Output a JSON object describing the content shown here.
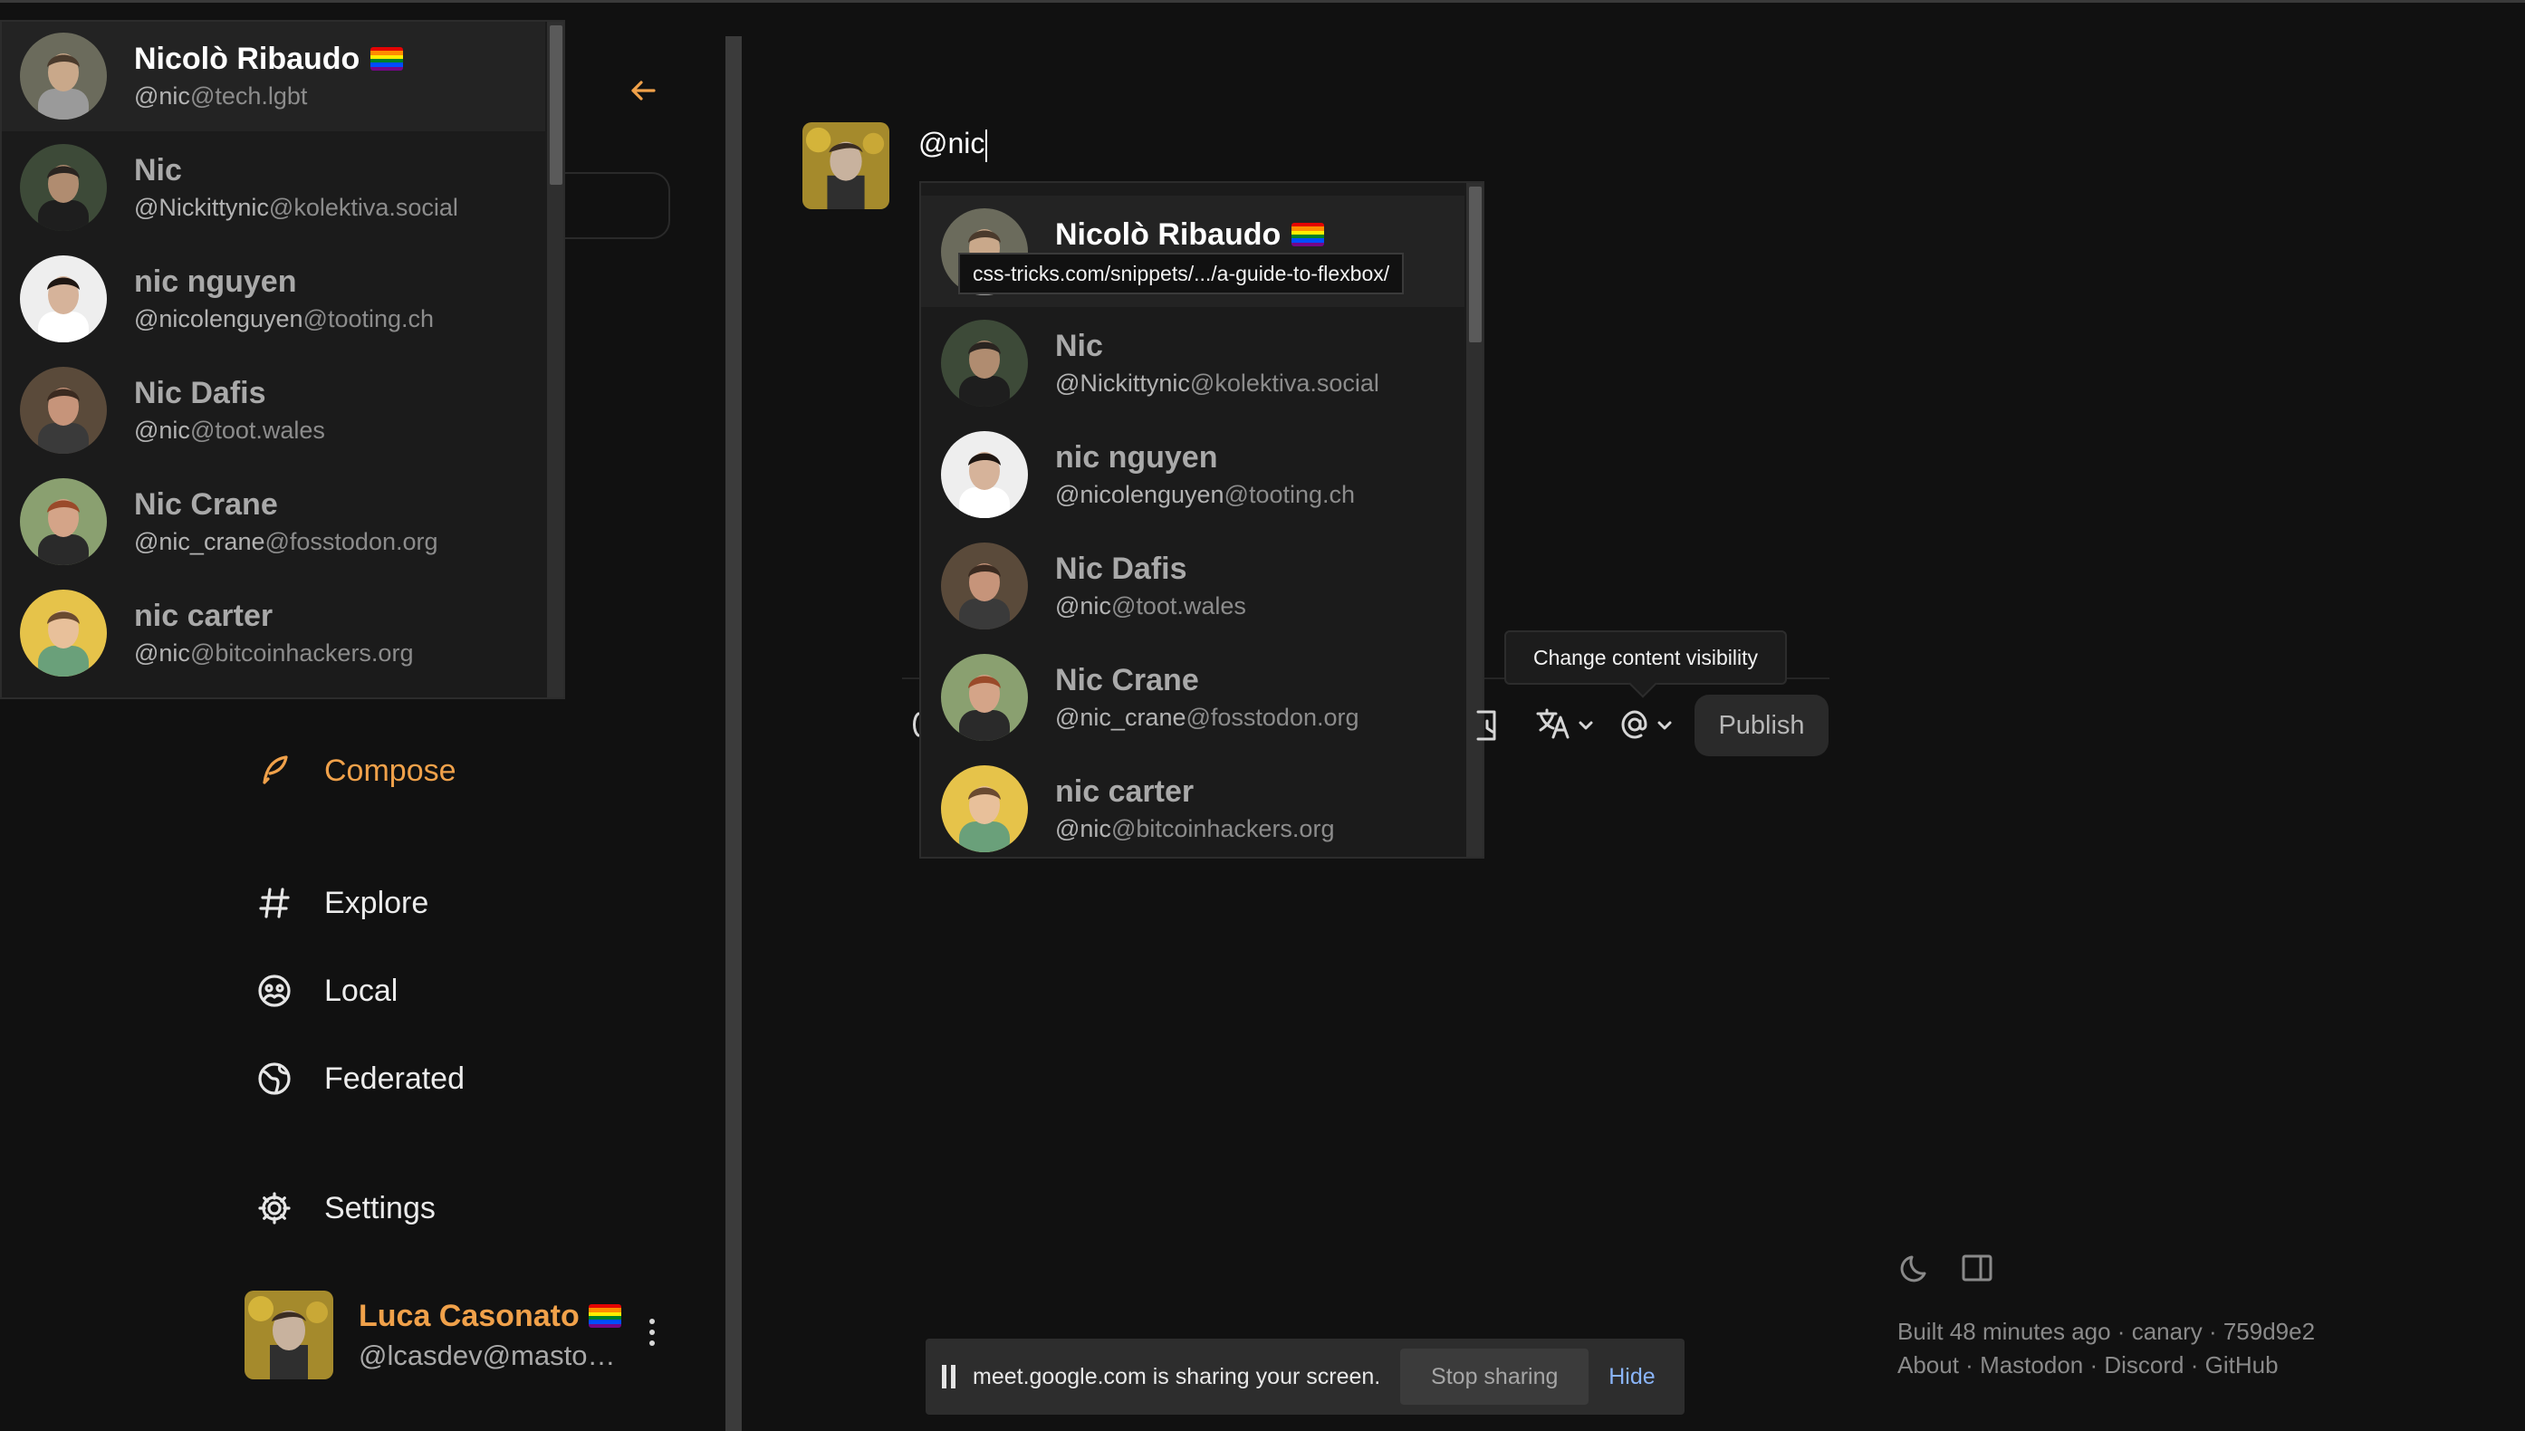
{
  "compose": {
    "input_text": "@nic",
    "link_tooltip": "css-tricks.com/snippets/.../a-guide-to-flexbox/",
    "visibility_tooltip": "Change content visibility",
    "publish_label": "Publish"
  },
  "accounts": [
    {
      "name": "Nicolò Ribaudo",
      "flag": true,
      "user": "@nic",
      "domain": "@tech.lgbt",
      "avatar": "man-young"
    },
    {
      "name": "Nic",
      "flag": false,
      "user": "@Nickittynic",
      "domain": "@kolektiva.social",
      "avatar": "man-cat"
    },
    {
      "name": "nic nguyen",
      "flag": false,
      "user": "@nicolenguyen",
      "domain": "@tooting.ch",
      "avatar": "woman"
    },
    {
      "name": "Nic Dafis",
      "flag": false,
      "user": "@nic",
      "domain": "@toot.wales",
      "avatar": "man-glasses"
    },
    {
      "name": "Nic Crane",
      "flag": false,
      "user": "@nic_crane",
      "domain": "@fosstodon.org",
      "avatar": "woman-glasses"
    },
    {
      "name": "nic carter",
      "flag": false,
      "user": "@nic",
      "domain": "@bitcoinhackers.org",
      "avatar": "man-beard-cartoon"
    }
  ],
  "nav": {
    "compose": "Compose",
    "explore": "Explore",
    "local": "Local",
    "federated": "Federated",
    "settings": "Settings"
  },
  "profile": {
    "name": "Luca Casonato",
    "handle": "@lcasdev@mastod..."
  },
  "footer": {
    "built": "Built 48 minutes ago · canary · 759d9e2",
    "links": [
      "About",
      "Mastodon",
      "Discord",
      "GitHub"
    ],
    "sep": " · "
  },
  "screen_share": {
    "text": "meet.google.com is sharing your screen.",
    "stop": "Stop sharing",
    "hide": "Hide"
  },
  "colors": {
    "accent": "#f0a14a",
    "background": "#111111",
    "link_blue": "#8ab4f8"
  }
}
